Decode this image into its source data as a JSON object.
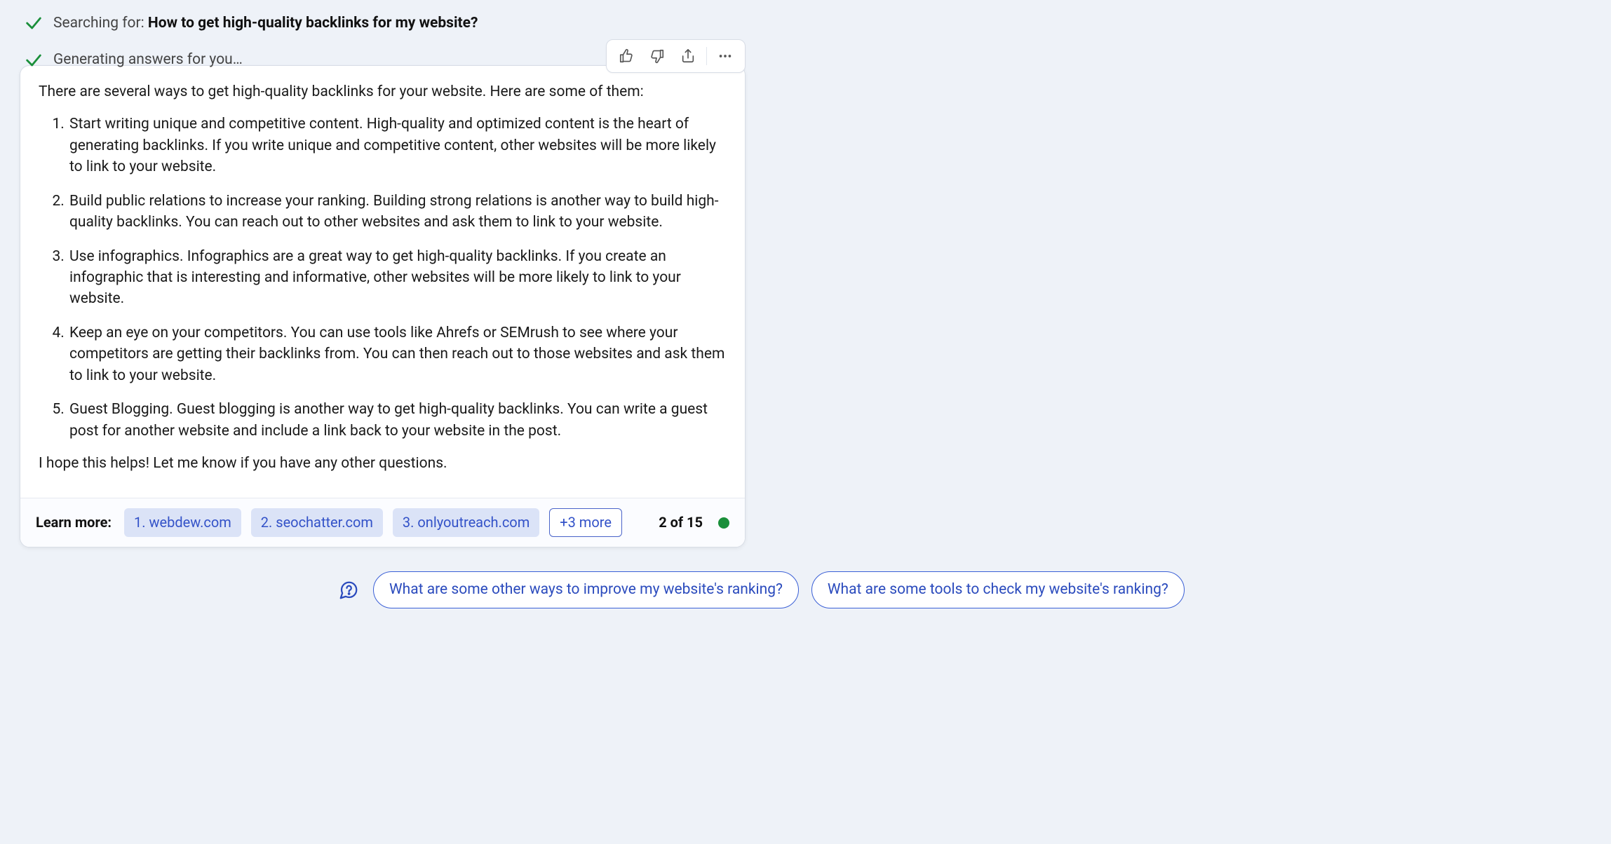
{
  "status": {
    "searching_label": "Searching for:",
    "searching_query": "How to get high-quality backlinks for my website?",
    "generating_label": "Generating answers for you…"
  },
  "feedback": {
    "like": "like-icon",
    "dislike": "dislike-icon",
    "share": "share-icon",
    "more": "more-icon"
  },
  "answer": {
    "intro": "There are several ways to get high-quality backlinks for your website. Here are some of them:",
    "items": [
      "Start writing unique and competitive content. High-quality and optimized content is the heart of generating backlinks. If you write unique and competitive content, other websites will be more likely to link to your website.",
      "Build public relations to increase your ranking. Building strong relations is another way to build high-quality backlinks. You can reach out to other websites and ask them to link to your website.",
      "Use infographics. Infographics are a great way to get high-quality backlinks. If you create an infographic that is interesting and informative, other websites will be more likely to link to your website.",
      "Keep an eye on your competitors. You can use tools like Ahrefs or SEMrush to see where your competitors are getting their backlinks from. You can then reach out to those websites and ask them to link to your website.",
      "Guest Blogging. Guest blogging is another way to get high-quality backlinks. You can write a guest post for another website and include a link back to your website in the post."
    ],
    "outro": "I hope this helps! Let me know if you have any other questions."
  },
  "learn_more": {
    "label": "Learn more:",
    "sources": [
      "1. webdew.com",
      "2. seochatter.com",
      "3. onlyoutreach.com"
    ],
    "more": "+3 more",
    "counter": "2 of 15",
    "status_color": "#1a8f3a"
  },
  "suggestions": [
    "What are some other ways to improve my website's ranking?",
    "What are some tools to check my website's ranking?"
  ]
}
